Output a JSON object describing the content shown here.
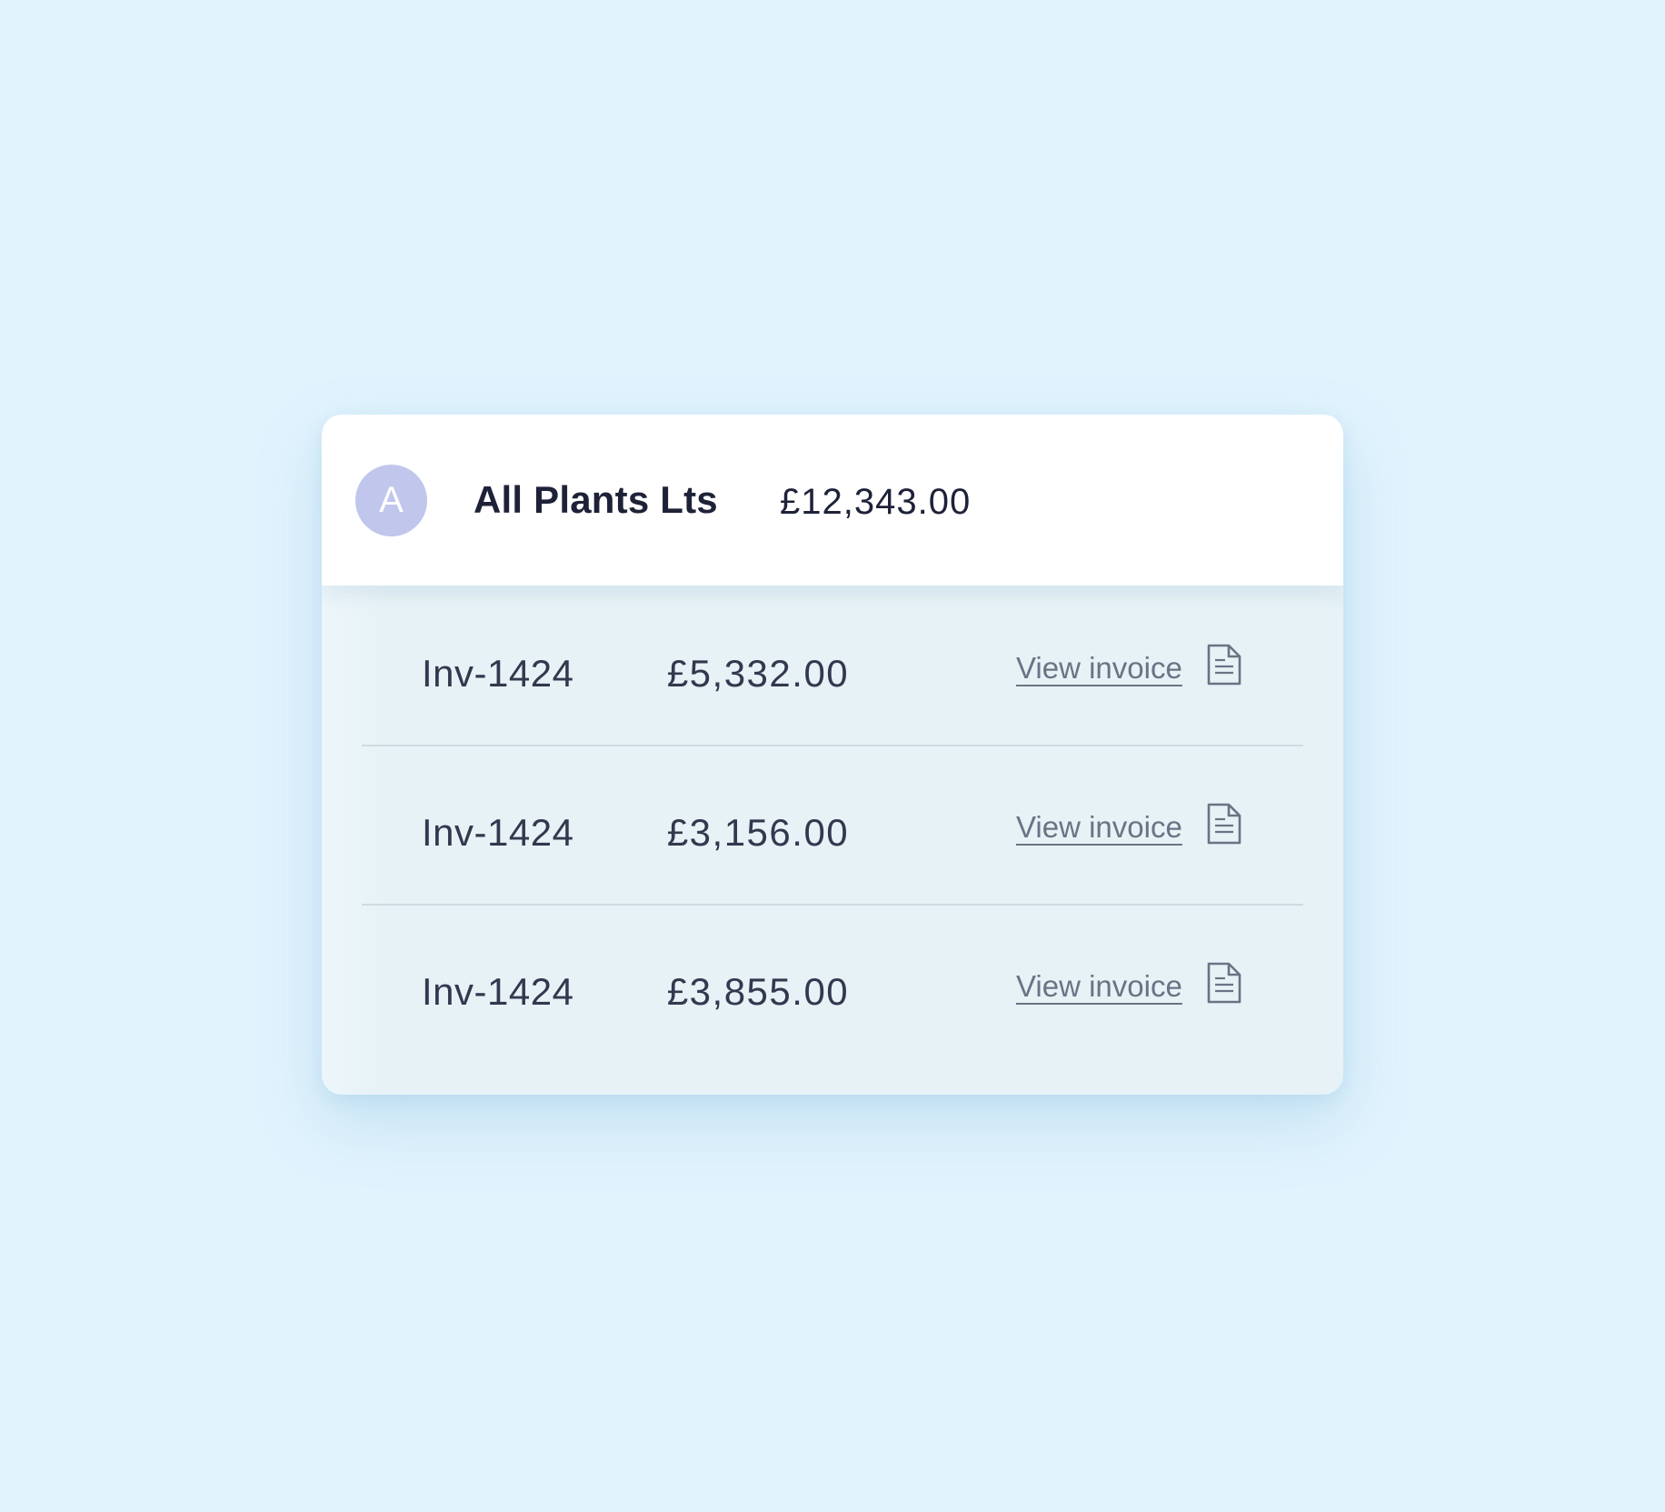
{
  "customer": {
    "avatar_initial": "A",
    "name": "All Plants Lts",
    "total": "£12,343.00"
  },
  "invoices": [
    {
      "id": "Inv-1424",
      "amount": "£5,332.00",
      "link_label": "View invoice",
      "icon": "document-icon"
    },
    {
      "id": "Inv-1424",
      "amount": "£3,156.00",
      "link_label": "View invoice",
      "icon": "document-icon"
    },
    {
      "id": "Inv-1424",
      "amount": "£3,855.00",
      "link_label": "View invoice",
      "icon": "document-icon"
    }
  ],
  "colors": {
    "background": "#e1f3fd",
    "header_bg": "#ffffff",
    "rows_bg": "#e6f2f6",
    "avatar_bg": "#c0c6ec",
    "text_primary": "#1e2238",
    "text_secondary": "#34384e",
    "link": "#6a7384"
  }
}
